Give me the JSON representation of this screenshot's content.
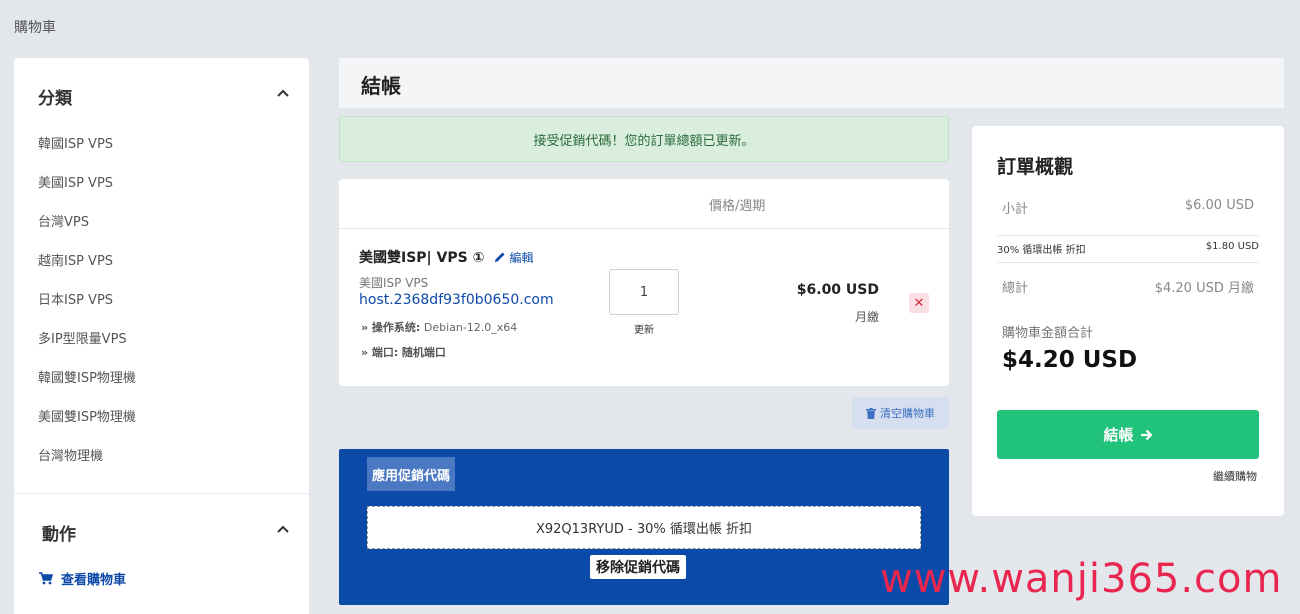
{
  "breadcrumb": "購物車",
  "sidebar": {
    "categories_heading": "分類",
    "items": [
      "韓國ISP VPS",
      "美國ISP VPS",
      "台灣VPS",
      "越南ISP VPS",
      "日本ISP VPS",
      "多IP型限量VPS",
      "韓國雙ISP物理機",
      "美國雙ISP物理機",
      "台灣物理機"
    ],
    "actions_heading": "動作",
    "view_cart": "查看購物車"
  },
  "page_title": "結帳",
  "alert": "接受促銷代碼！您的訂單總額已更新。",
  "cart": {
    "col_price": "價格/週期",
    "product_name": "美國雙ISP| VPS ①",
    "edit_label": "編輯",
    "group": "美國ISP VPS",
    "hostname": "host.2368df93f0b0650.com",
    "opt1_label": "» 操作系统:",
    "opt1_value": "Debian-12.0_x64",
    "opt2_label": "» 端口:",
    "opt2_value": "随机端口",
    "quantity": "1",
    "update_label": "更新",
    "price": "$6.00 USD",
    "cycle": "月繳",
    "remove_symbol": "✕"
  },
  "empty_cart": "清空購物車",
  "promo": {
    "tab_label": "應用促銷代碼",
    "code_text": "X92Q13RYUD - 30% 循環出帳 折扣",
    "remove_label": "移除促銷代碼"
  },
  "summary": {
    "title": "訂單概觀",
    "subtotal_label": "小計",
    "subtotal_value": "$6.00 USD",
    "discount_label": "30% 循環出帳 折扣",
    "discount_value": "$1.80 USD",
    "total_label": "總計",
    "total_value": "$4.20 USD 月繳",
    "cart_total_label": "購物車金額合計",
    "cart_total_value": "$4.20 USD",
    "checkout_label": "結帳",
    "continue_label": "繼續購物"
  },
  "watermark": "www.wanji365.com",
  "colors": {
    "brand_blue": "#0b4aa8",
    "checkout_green": "#21c27a",
    "alert_green": "#d9eedd",
    "danger_red": "#d9263f"
  }
}
